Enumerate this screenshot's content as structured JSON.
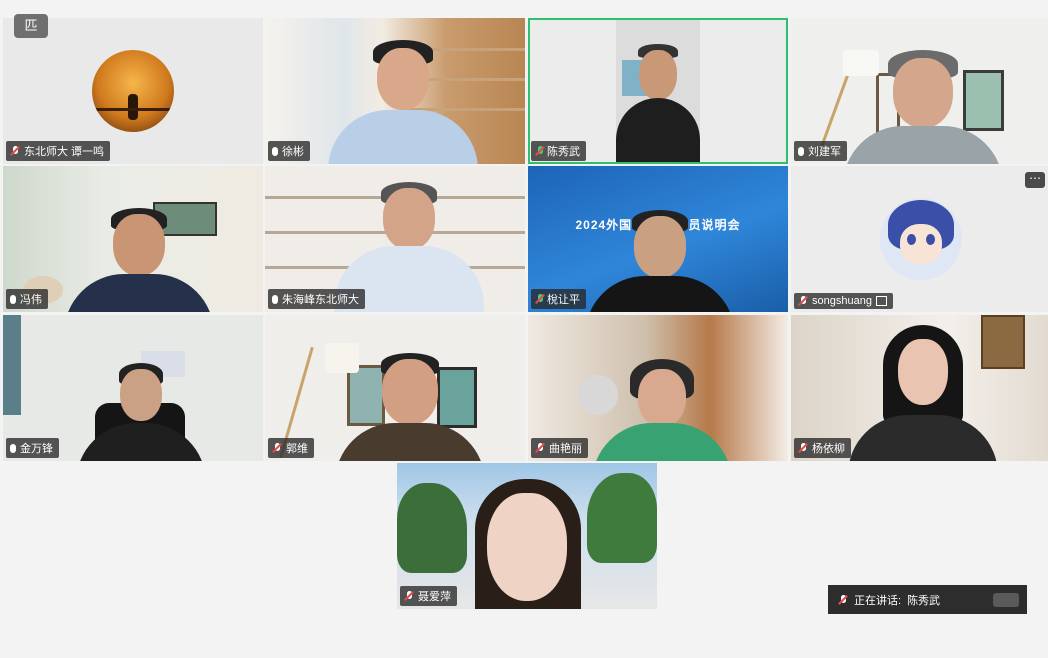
{
  "corner_button": {
    "icon": "minimize-layout-icon",
    "label": "匹"
  },
  "participants": [
    {
      "name": "东北师大 谭一鸣",
      "mic": "muted"
    },
    {
      "name": "徐彬",
      "mic": "on"
    },
    {
      "name": "陈秀武",
      "mic": "speaking",
      "active": true
    },
    {
      "name": "刘建军",
      "mic": "on"
    },
    {
      "name": "冯伟",
      "mic": "on"
    },
    {
      "name": "朱海峰东北师大",
      "mic": "on"
    },
    {
      "name": "梲让平",
      "mic": "speaking"
    },
    {
      "name": "songshuang",
      "mic": "muted",
      "extra_icon": "screen-share-icon",
      "more": "⋯"
    },
    {
      "name": "金万锋",
      "mic": "on"
    },
    {
      "name": "郭维",
      "mic": "muted"
    },
    {
      "name": "曲艳丽",
      "mic": "muted"
    },
    {
      "name": "杨依柳",
      "mic": "muted"
    },
    {
      "name": "聂爱萍",
      "mic": "muted"
    }
  ],
  "banner_text": "2024外国语学     迁动员说明会",
  "speaking_bar": {
    "label": "正在讲话:",
    "speaker": "陈秀武"
  }
}
